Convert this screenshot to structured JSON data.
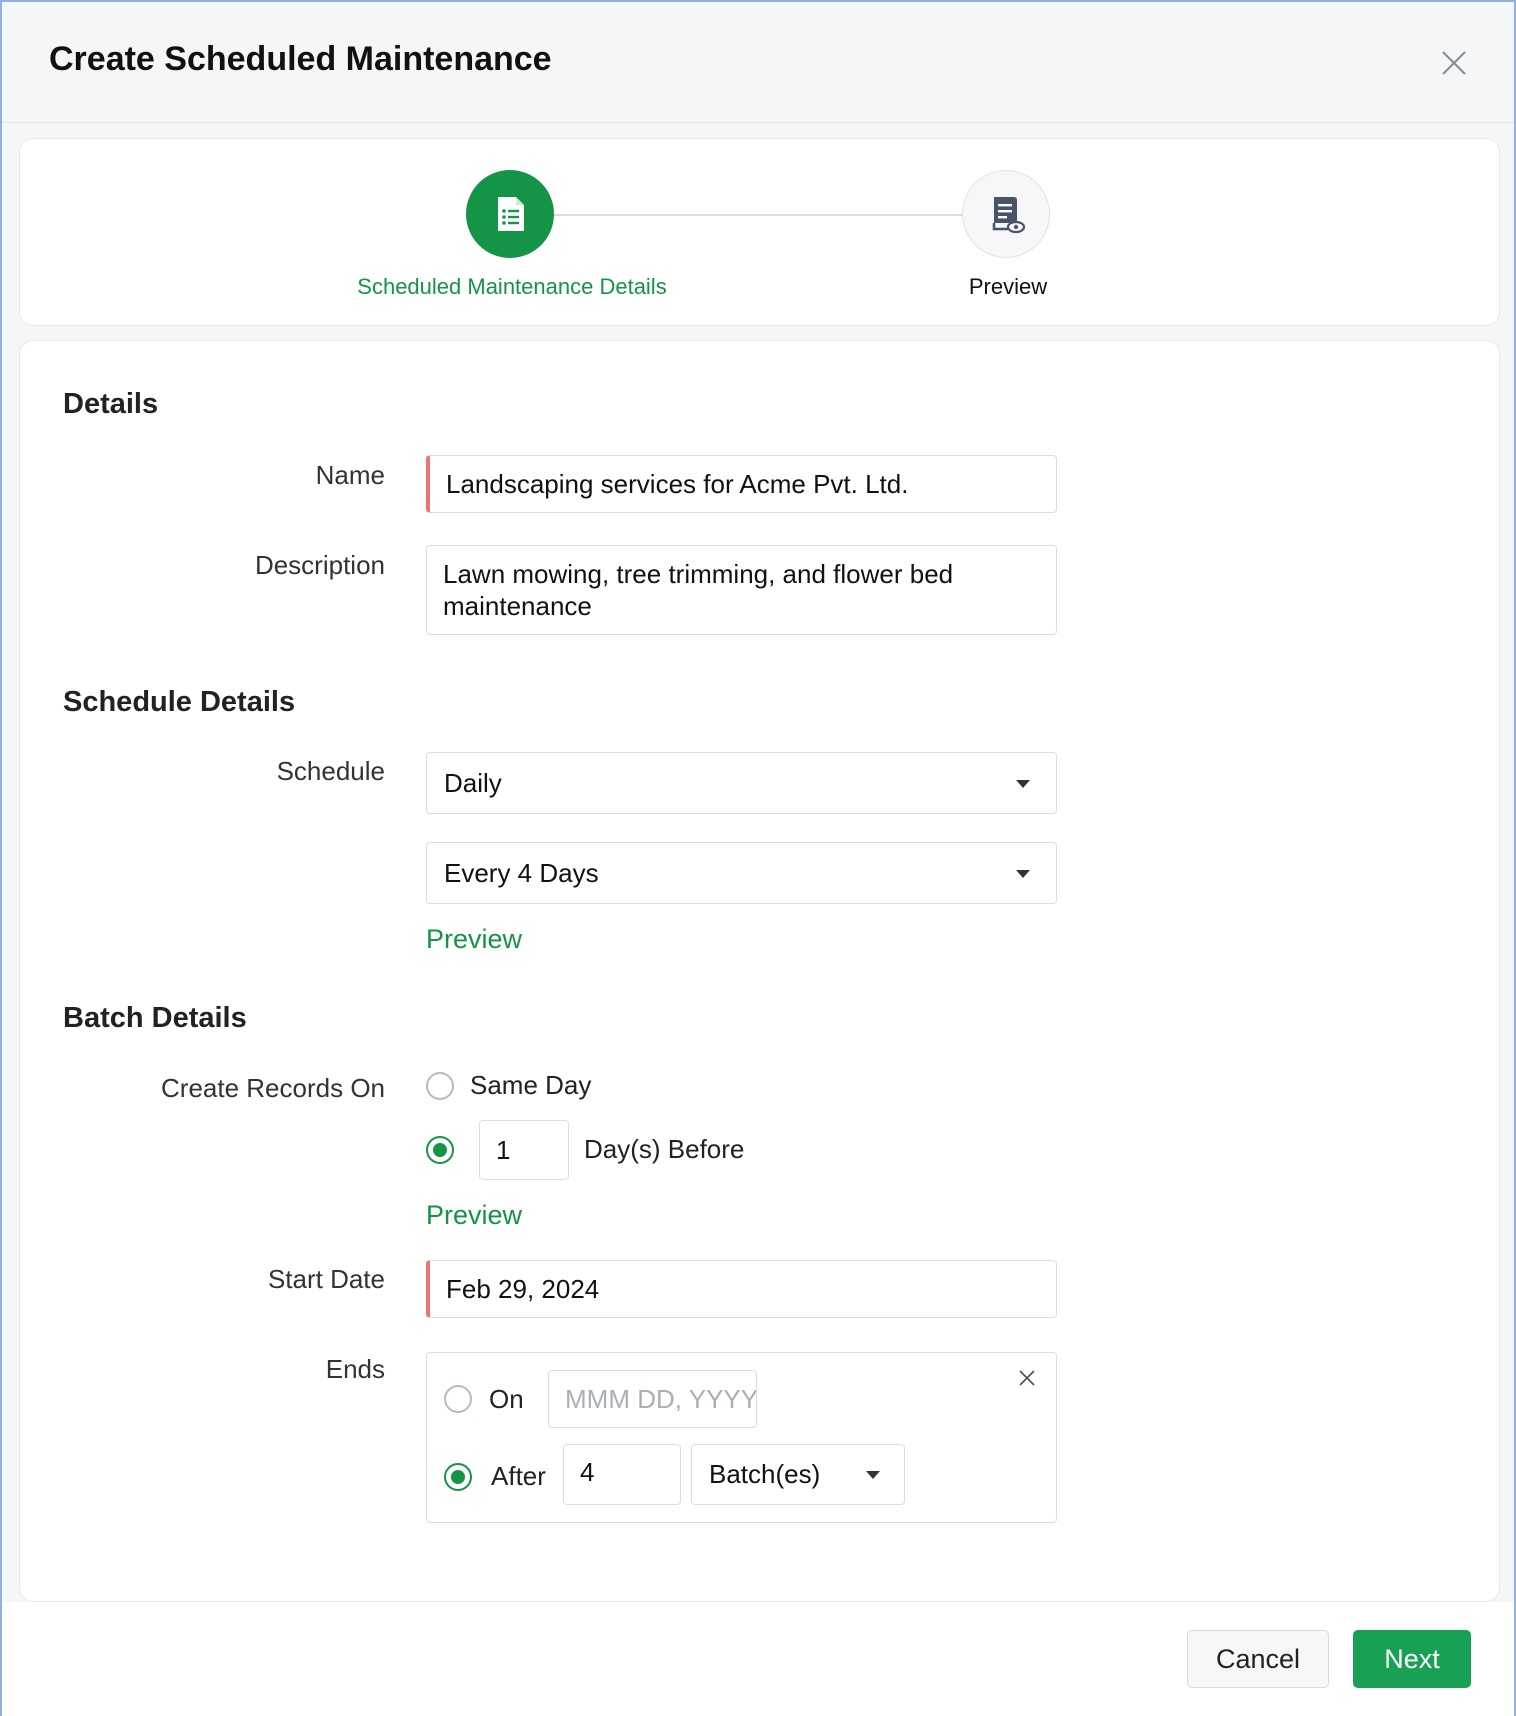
{
  "dialog": {
    "title": "Create Scheduled Maintenance",
    "close_icon": "close-icon"
  },
  "stepper": {
    "steps": [
      {
        "label": "Scheduled Maintenance Details",
        "icon": "document-list-icon",
        "state": "active"
      },
      {
        "label": "Preview",
        "icon": "document-eye-icon",
        "state": "inactive"
      }
    ]
  },
  "details": {
    "section_title": "Details",
    "name_label": "Name",
    "name_value": "Landscaping services for Acme Pvt. Ltd.",
    "description_label": "Description",
    "description_value": "Lawn mowing, tree trimming, and flower bed maintenance"
  },
  "schedule": {
    "section_title": "Schedule Details",
    "schedule_label": "Schedule",
    "frequency_value": "Daily",
    "interval_value": "Every 4 Days",
    "preview_link": "Preview"
  },
  "batch": {
    "section_title": "Batch Details",
    "create_records_label": "Create Records On",
    "same_day_label": "Same Day",
    "days_before_value": "1",
    "days_before_label": "Day(s) Before",
    "selected_option": "days_before",
    "preview_link": "Preview",
    "start_date_label": "Start Date",
    "start_date_value": "Feb 29, 2024",
    "ends_label": "Ends",
    "ends_on_label": "On",
    "ends_on_placeholder": "MMM DD, YYYY",
    "ends_after_label": "After",
    "ends_after_value": "4",
    "ends_after_unit": "Batch(es)",
    "ends_selected": "after"
  },
  "footer": {
    "cancel_label": "Cancel",
    "next_label": "Next"
  },
  "colors": {
    "accent_green": "#149447",
    "required_marker": "#e9766e",
    "button_green": "#18a055"
  }
}
